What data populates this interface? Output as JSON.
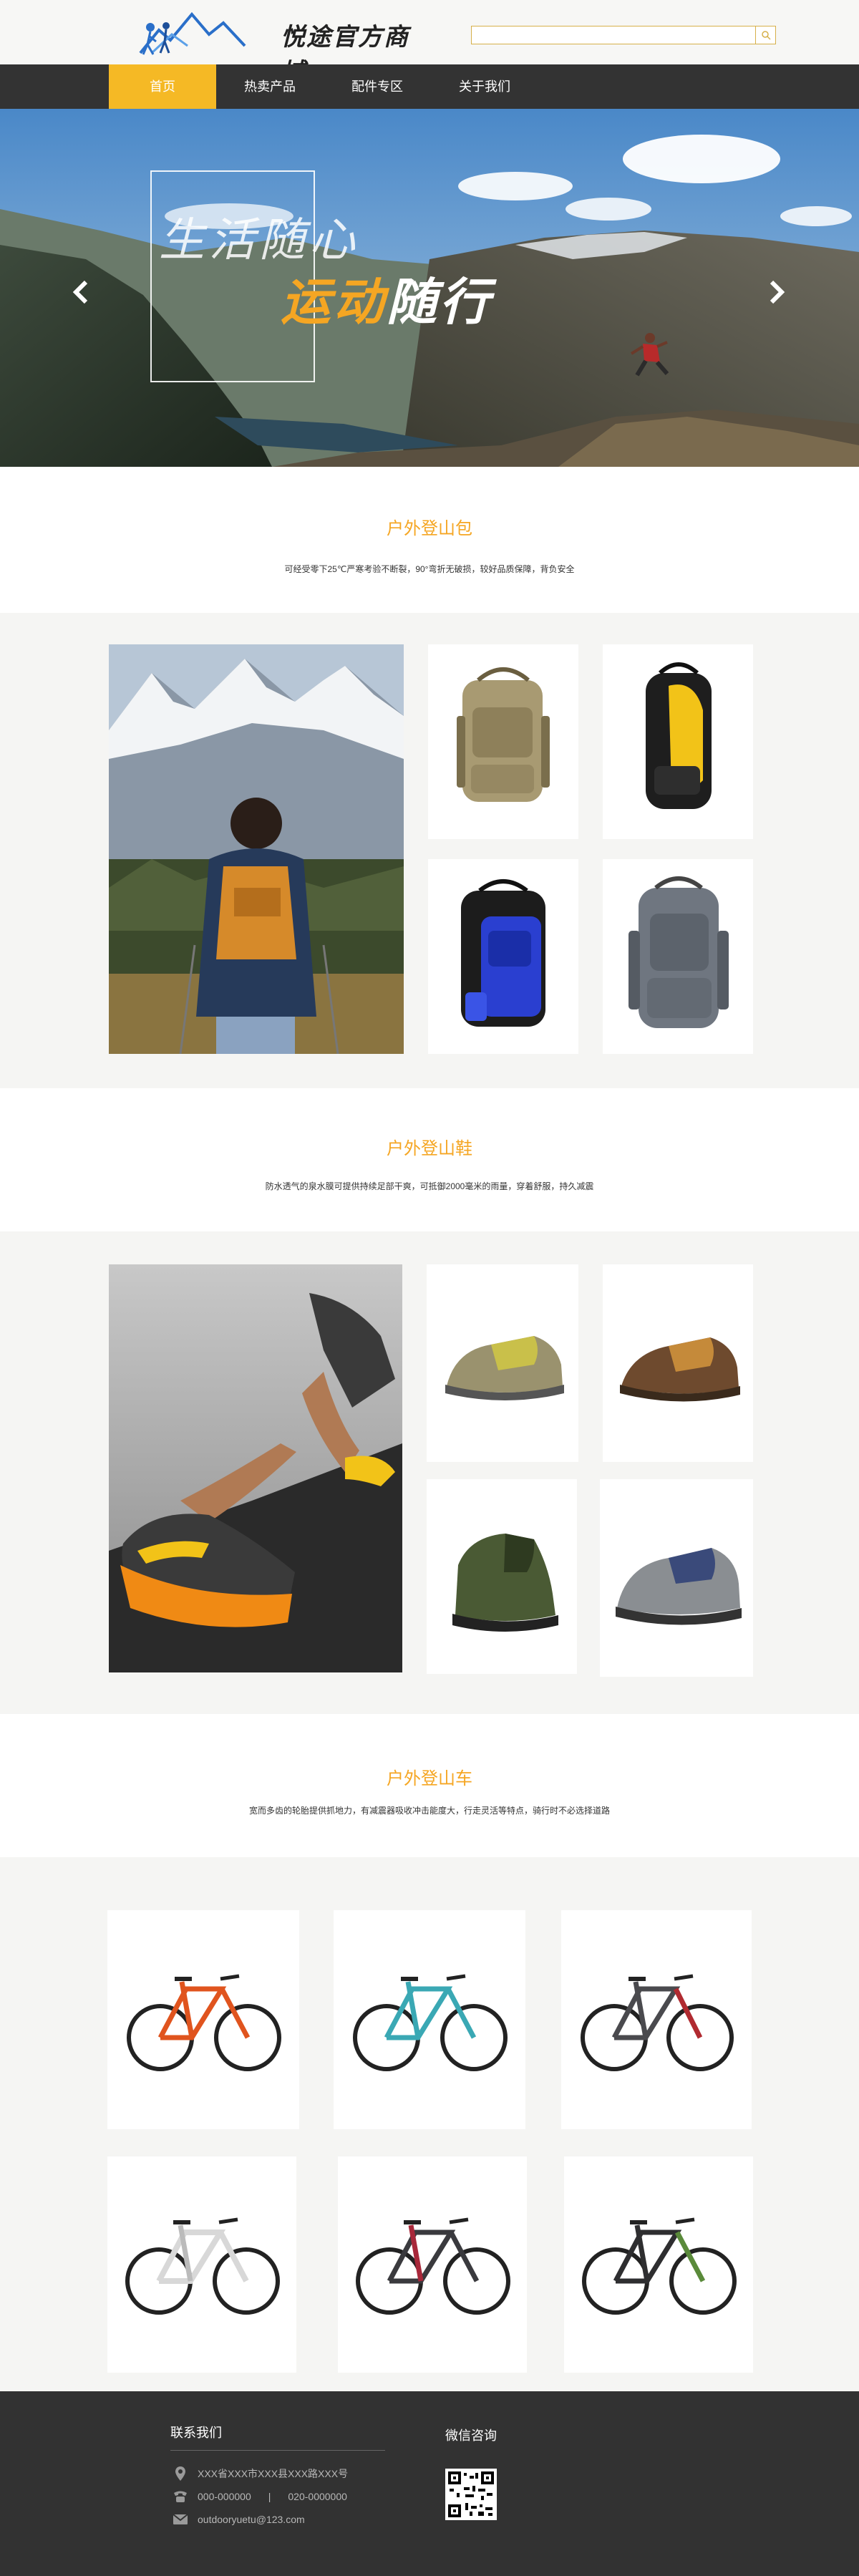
{
  "header": {
    "logo_text": "悦途官方商城",
    "search": {
      "value": "",
      "placeholder": ""
    }
  },
  "nav": {
    "items": [
      {
        "label": "首页"
      },
      {
        "label": "热卖产品"
      },
      {
        "label": "配件专区"
      },
      {
        "label": "关于我们"
      }
    ]
  },
  "banner": {
    "slogan_line1": "生活随心",
    "slogan_line2_highlight": "运动",
    "slogan_line2_rest": "随行"
  },
  "sections": {
    "backpacks": {
      "title": "户外登山包",
      "desc": "可经受零下25℃严寒考验不断裂，90°弯折无破损，较好品质保障，背负安全"
    },
    "shoes": {
      "title": "户外登山鞋",
      "desc": "防水透气的泉水膜可提供持续足部干爽，可抵御2000毫米的雨量，穿着舒服，持久减震"
    },
    "bikes": {
      "title": "户外登山车",
      "desc": "宽而多齿的轮胎提供抓地力，有减震器吸收冲击能度大，行走灵活等特点，骑行时不必选择道路"
    }
  },
  "colors": {
    "accent": "#f5b925",
    "title_orange": "#f5a623",
    "nav_bg": "#333333",
    "footer_bg": "#323232"
  },
  "footer": {
    "contact_title": "联系我们",
    "address": "XXX省XXX市XXX县XXX路XXX号",
    "phone1": "000-000000",
    "phone_sep": "|",
    "phone2": "020-0000000",
    "email": "outdooryuetu@123.com",
    "wechat_title": "微信咨询",
    "icons": [
      "location-icon",
      "phone-icon",
      "mail-icon"
    ]
  }
}
